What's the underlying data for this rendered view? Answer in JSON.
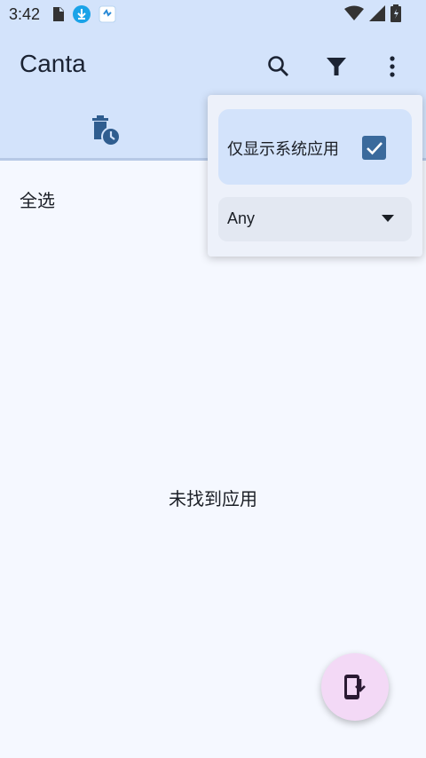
{
  "status_bar": {
    "time": "3:42",
    "icons": [
      "sim-icon",
      "download-icon",
      "app-notification-icon",
      "wifi-icon",
      "signal-icon",
      "battery-icon"
    ]
  },
  "app_bar": {
    "title": "Canta",
    "actions": [
      "search-icon",
      "filter-icon",
      "more-vert-icon"
    ]
  },
  "tabs": {
    "icons": [
      "delete-history-icon"
    ]
  },
  "list": {
    "select_all_label": "全选",
    "empty_message": "未找到应用"
  },
  "filter_menu": {
    "system_apps_label": "仅显示系统应用",
    "system_apps_checked": true,
    "dropdown_value": "Any"
  },
  "fab": {
    "icon": "install-app-icon"
  },
  "colors": {
    "app_bar_bg": "#d3e3fb",
    "page_bg": "#f5f8ff",
    "checkbox": "#3a6a9c",
    "fab_bg": "#f3d9f6"
  }
}
